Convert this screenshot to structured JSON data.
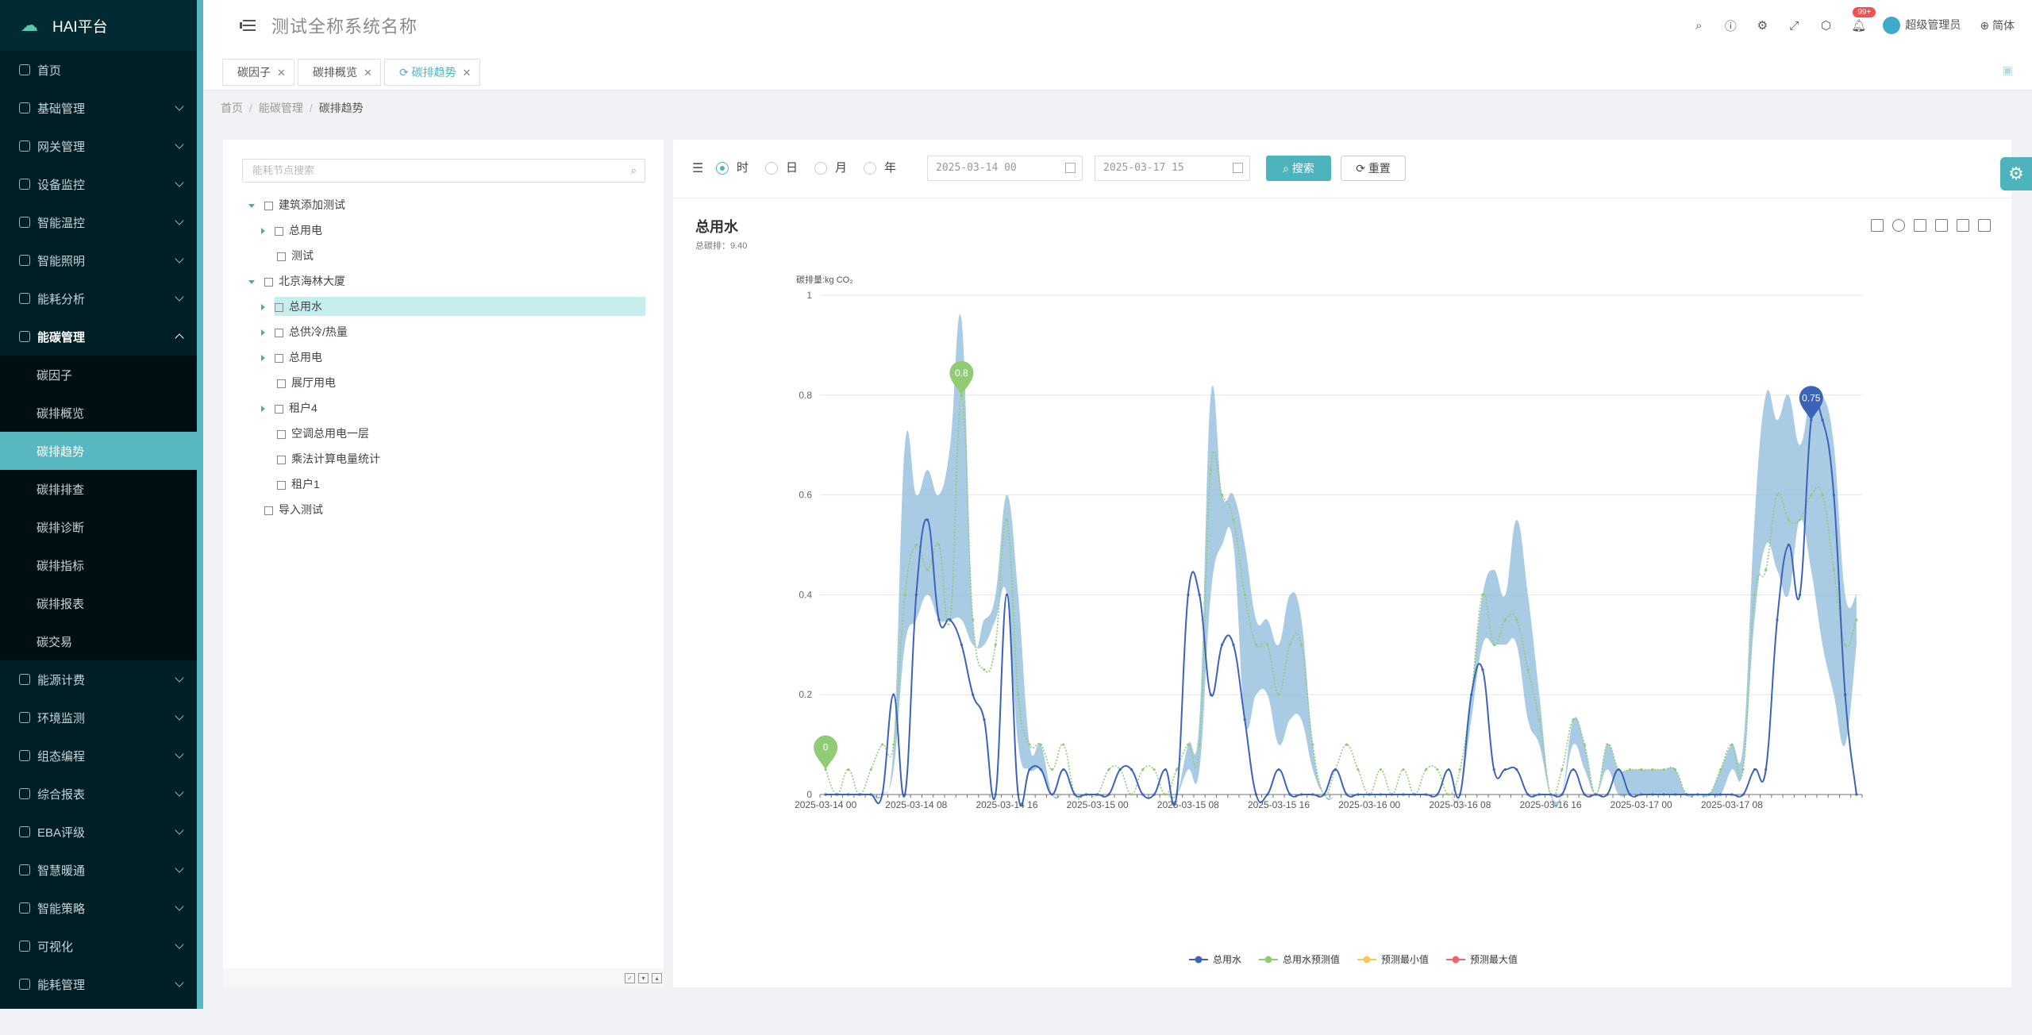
{
  "app": {
    "logo_text": "HAI平台",
    "system_title": "测试全称系统名称"
  },
  "sidebar": {
    "items": [
      {
        "label": "首页",
        "icon": "dashboard-icon",
        "has_children": false
      },
      {
        "label": "基础管理",
        "icon": "database-icon",
        "has_children": true
      },
      {
        "label": "网关管理",
        "icon": "gateway-icon",
        "has_children": true
      },
      {
        "label": "设备监控",
        "icon": "monitor-icon",
        "has_children": true
      },
      {
        "label": "智能温控",
        "icon": "thermostat-icon",
        "has_children": true
      },
      {
        "label": "智能照明",
        "icon": "bulb-icon",
        "has_children": true
      },
      {
        "label": "能耗分析",
        "icon": "chart-icon",
        "has_children": true
      },
      {
        "label": "能碳管理",
        "icon": "cloud-icon",
        "has_children": true,
        "open": true
      }
    ],
    "submenu": [
      {
        "label": "碳因子",
        "active": false
      },
      {
        "label": "碳排概览",
        "active": false
      },
      {
        "label": "碳排趋势",
        "active": true
      },
      {
        "label": "碳排排查",
        "active": false
      },
      {
        "label": "碳排诊断",
        "active": false
      },
      {
        "label": "碳排指标",
        "active": false
      },
      {
        "label": "碳排报表",
        "active": false
      },
      {
        "label": "碳交易",
        "active": false
      }
    ],
    "items_after": [
      {
        "label": "能源计费",
        "icon": "billing-icon"
      },
      {
        "label": "环境监测",
        "icon": "leaf-icon"
      },
      {
        "label": "组态编程",
        "icon": "program-icon"
      },
      {
        "label": "综合报表",
        "icon": "report-icon"
      },
      {
        "label": "EBA评级",
        "icon": "rating-icon"
      },
      {
        "label": "智慧暖通",
        "icon": "hvac-icon"
      },
      {
        "label": "智能策略",
        "icon": "strategy-icon"
      },
      {
        "label": "可视化",
        "icon": "visual-icon"
      },
      {
        "label": "能耗管理",
        "icon": "energy-icon"
      }
    ]
  },
  "header": {
    "notification_badge": "99+",
    "user_name": "超级管理员",
    "language": "简体"
  },
  "tabs": [
    {
      "label": "碳因子",
      "active": false
    },
    {
      "label": "碳排概览",
      "active": false
    },
    {
      "label": "碳排趋势",
      "active": true
    }
  ],
  "breadcrumb": [
    "首页",
    "能碳管理",
    "碳排趋势"
  ],
  "tree": {
    "search_placeholder": "能耗节点搜索",
    "nodes": [
      {
        "label": "建筑添加测试",
        "level": 0,
        "expander": "open",
        "selected": false
      },
      {
        "label": "总用电",
        "level": 1,
        "expander": "closed",
        "selected": false
      },
      {
        "label": "测试",
        "level": 1,
        "expander": "none",
        "selected": false
      },
      {
        "label": "北京海林大厦",
        "level": 0,
        "expander": "open",
        "selected": false
      },
      {
        "label": "总用水",
        "level": 1,
        "expander": "closed",
        "selected": true
      },
      {
        "label": "总供冷/热量",
        "level": 1,
        "expander": "closed",
        "selected": false
      },
      {
        "label": "总用电",
        "level": 1,
        "expander": "closed",
        "selected": false
      },
      {
        "label": "展厅用电",
        "level": 1,
        "expander": "none",
        "selected": false
      },
      {
        "label": "租户4",
        "level": 1,
        "expander": "closed",
        "selected": false
      },
      {
        "label": "空调总用电一层",
        "level": 1,
        "expander": "none",
        "selected": false
      },
      {
        "label": "乘法计算电量统计",
        "level": 1,
        "expander": "none",
        "selected": false
      },
      {
        "label": "租户1",
        "level": 1,
        "expander": "none",
        "selected": false
      },
      {
        "label": "导入测试",
        "level": 0,
        "expander": "none",
        "selected": false
      }
    ]
  },
  "filter": {
    "granularity": [
      {
        "label": "时",
        "checked": true
      },
      {
        "label": "日",
        "checked": false
      },
      {
        "label": "月",
        "checked": false
      },
      {
        "label": "年",
        "checked": false
      }
    ],
    "start": "2025-03-14 00",
    "end": "2025-03-17 15",
    "search_label": "搜索",
    "reset_label": "重置"
  },
  "chart_data": {
    "type": "line",
    "title": "总用水",
    "subtitle": "总碳排：9.40",
    "ylabel": "碳排量:kg CO₂",
    "ylim": [
      0,
      1
    ],
    "yticks": [
      0,
      0.2,
      0.4,
      0.6,
      0.8,
      1
    ],
    "x_start": "2025-03-14 00",
    "x_step_hours": 1,
    "xtick_labels": [
      "2025-03-14 00",
      "2025-03-14 08",
      "2025-03-14 16",
      "2025-03-15 00",
      "2025-03-15 08",
      "2025-03-15 16",
      "2025-03-16 00",
      "2025-03-16 08",
      "2025-03-16 16",
      "2025-03-17 00",
      "2025-03-17 08"
    ],
    "xtick_every": 8,
    "legend": [
      {
        "name": "总用水",
        "color": "#3d63b8"
      },
      {
        "name": "总用水预测值",
        "color": "#91cc75"
      },
      {
        "name": "预测最小值",
        "color": "#fac858"
      },
      {
        "name": "预测最大值",
        "color": "#ee6666"
      }
    ],
    "band_color": "#8cb9d9",
    "series": [
      {
        "name": "总用水",
        "values": [
          0,
          0,
          0,
          0,
          0,
          0,
          0.2,
          0,
          0.4,
          0.55,
          0.35,
          0.35,
          0.3,
          0.2,
          0.15,
          0,
          0.4,
          0,
          0.05,
          0.05,
          0,
          0.05,
          0,
          0,
          0,
          0,
          0.05,
          0.05,
          0,
          0,
          0.05,
          0,
          0.4,
          0.4,
          0.2,
          0.3,
          0.3,
          0.15,
          0,
          0,
          0.05,
          0,
          0,
          0,
          0,
          0.05,
          0,
          0,
          0,
          0,
          0,
          0,
          0,
          0,
          0,
          0.05,
          0,
          0.2,
          0.25,
          0.05,
          0.05,
          0.05,
          0,
          0,
          0,
          0,
          0.05,
          0,
          0,
          0,
          0.05,
          0,
          0,
          0,
          0,
          0,
          0,
          0,
          0,
          0,
          0,
          0,
          0.05,
          0.05,
          0.35,
          0.5,
          0.4,
          0.75,
          0.75,
          0.6,
          0.2,
          0
        ]
      },
      {
        "name": "总用水预测值",
        "values": [
          0.05,
          0,
          0.05,
          0,
          0.05,
          0.1,
          0.1,
          0.4,
          0.5,
          0.45,
          0.5,
          0.35,
          0.8,
          0.35,
          0.25,
          0.3,
          0.55,
          0.2,
          0.1,
          0.1,
          0.05,
          0.1,
          0,
          0,
          0,
          0.05,
          0.05,
          0,
          0.05,
          0.05,
          0,
          0.05,
          0.1,
          0.1,
          0.65,
          0.6,
          0.55,
          0.4,
          0.3,
          0.3,
          0.2,
          0.3,
          0.3,
          0.1,
          0,
          0.05,
          0.1,
          0.05,
          0,
          0.05,
          0,
          0.05,
          0,
          0.05,
          0.05,
          0,
          0.05,
          0.2,
          0.4,
          0.3,
          0.35,
          0.35,
          0.25,
          0.15,
          0,
          0.05,
          0.15,
          0.1,
          0,
          0.1,
          0.05,
          0.05,
          0.05,
          0.05,
          0.05,
          0.05,
          0,
          0,
          0,
          0.05,
          0.1,
          0.05,
          0.4,
          0.45,
          0.6,
          0.55,
          0.55,
          0.6,
          0.6,
          0.45,
          0.3,
          0.35
        ]
      },
      {
        "name": "预测最小值",
        "values": [
          0,
          0,
          0,
          0,
          0,
          0,
          0.05,
          0.3,
          0.35,
          0.4,
          0.35,
          0.35,
          0.35,
          0.3,
          0.3,
          0.35,
          0.4,
          0.1,
          0.05,
          0.05,
          0,
          0,
          0,
          0,
          0,
          0,
          0,
          0,
          0,
          0,
          0,
          0,
          0.05,
          0.05,
          0.4,
          0.5,
          0.5,
          0.15,
          0.2,
          0.2,
          0.1,
          0.15,
          0.15,
          0.05,
          0,
          0,
          0.05,
          0,
          0,
          0,
          0,
          0,
          0,
          0,
          0,
          0,
          0,
          0.15,
          0.3,
          0.3,
          0.3,
          0.3,
          0.15,
          0.1,
          0,
          0,
          0.1,
          0.05,
          0,
          0.05,
          0,
          0,
          0,
          0,
          0,
          0,
          0,
          0,
          0,
          0,
          0.05,
          0.05,
          0.35,
          0.5,
          0.45,
          0.4,
          0.55,
          0.45,
          0.3,
          0.2,
          0.1,
          0.3
        ]
      },
      {
        "name": "预测最大值",
        "values": [
          0,
          0,
          0,
          0,
          0,
          0,
          0.1,
          0.7,
          0.6,
          0.65,
          0.6,
          0.7,
          0.95,
          0.35,
          0.35,
          0.4,
          0.6,
          0.4,
          0.1,
          0.1,
          0,
          0,
          0,
          0,
          0,
          0,
          0,
          0,
          0,
          0,
          0,
          0,
          0.1,
          0.15,
          0.8,
          0.6,
          0.6,
          0.5,
          0.35,
          0.35,
          0.3,
          0.4,
          0.35,
          0.1,
          0,
          0,
          0.05,
          0,
          0,
          0,
          0,
          0,
          0,
          0,
          0,
          0,
          0,
          0.2,
          0.4,
          0.45,
          0.4,
          0.55,
          0.4,
          0.2,
          0,
          0,
          0.15,
          0.1,
          0,
          0.1,
          0.05,
          0.05,
          0.05,
          0.05,
          0.05,
          0.05,
          0,
          0,
          0,
          0.05,
          0.1,
          0.1,
          0.55,
          0.8,
          0.75,
          0.8,
          0.7,
          0.8,
          0.8,
          0.7,
          0.4,
          0.4
        ]
      }
    ],
    "markers": [
      {
        "series": "总用水预测值",
        "index": 0,
        "label": "0",
        "color": "#91cc75"
      },
      {
        "series": "总用水预测值",
        "index": 12,
        "label": "0.8",
        "color": "#91cc75"
      },
      {
        "series": "总用水",
        "index": 87,
        "label": "0.75",
        "color": "#3d63b8"
      }
    ]
  }
}
